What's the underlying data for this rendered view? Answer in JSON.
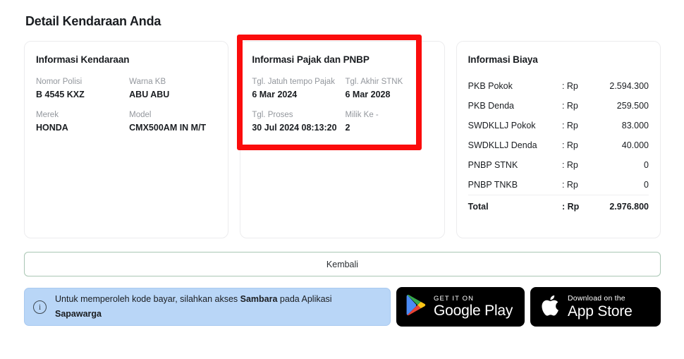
{
  "page": {
    "title": "Detail Kendaraan Anda"
  },
  "vehicle_card": {
    "title": "Informasi Kendaraan",
    "fields": [
      {
        "label": "Nomor Polisi",
        "value": "B 4545 KXZ"
      },
      {
        "label": "Warna KB",
        "value": "ABU ABU"
      },
      {
        "label": "Merek",
        "value": "HONDA"
      },
      {
        "label": "Model",
        "value": "CMX500AM IN M/T"
      }
    ]
  },
  "tax_card": {
    "title": "Informasi Pajak dan PNBP",
    "highlighted": true,
    "highlight_color": "#fb0c0c",
    "fields": [
      {
        "label": "Tgl. Jatuh tempo Pajak",
        "value": "6 Mar 2024"
      },
      {
        "label": "Tgl. Akhir STNK",
        "value": "6 Mar 2028"
      },
      {
        "label": "Tgl. Proses",
        "value": "30 Jul 2024 08:13:20"
      },
      {
        "label": "Milik Ke -",
        "value": "2"
      }
    ]
  },
  "cost_card": {
    "title": "Informasi Biaya",
    "currency": ": Rp",
    "rows": [
      {
        "name": "PKB Pokok",
        "currency": ": Rp",
        "value": "2.594.300"
      },
      {
        "name": "PKB Denda",
        "currency": ": Rp",
        "value": "259.500"
      },
      {
        "name": "SWDKLLJ Pokok",
        "currency": ": Rp",
        "value": "83.000"
      },
      {
        "name": "SWDKLLJ Denda",
        "currency": ": Rp",
        "value": "40.000"
      },
      {
        "name": "PNBP STNK",
        "currency": ": Rp",
        "value": "0"
      },
      {
        "name": "PNBP TNKB",
        "currency": ": Rp",
        "value": "0"
      }
    ],
    "total": {
      "name": "Total",
      "currency": ": Rp",
      "value": "2.976.800"
    }
  },
  "back_button": {
    "label": "Kembali"
  },
  "info_banner": {
    "icon": "info-circle-icon",
    "text_before": "Untuk memperoleh kode bayar, silahkan akses ",
    "text_bold_1": "Sambara",
    "text_middle": " pada Aplikasi ",
    "text_bold_2": "Sapawarga",
    "background": "#b9d6f7"
  },
  "store_badges": {
    "google": {
      "small": "GET IT ON",
      "big": "Google Play",
      "icon": "google-play-icon"
    },
    "apple": {
      "small": "Download on the",
      "big": "App Store",
      "icon": "apple-logo-icon"
    }
  }
}
